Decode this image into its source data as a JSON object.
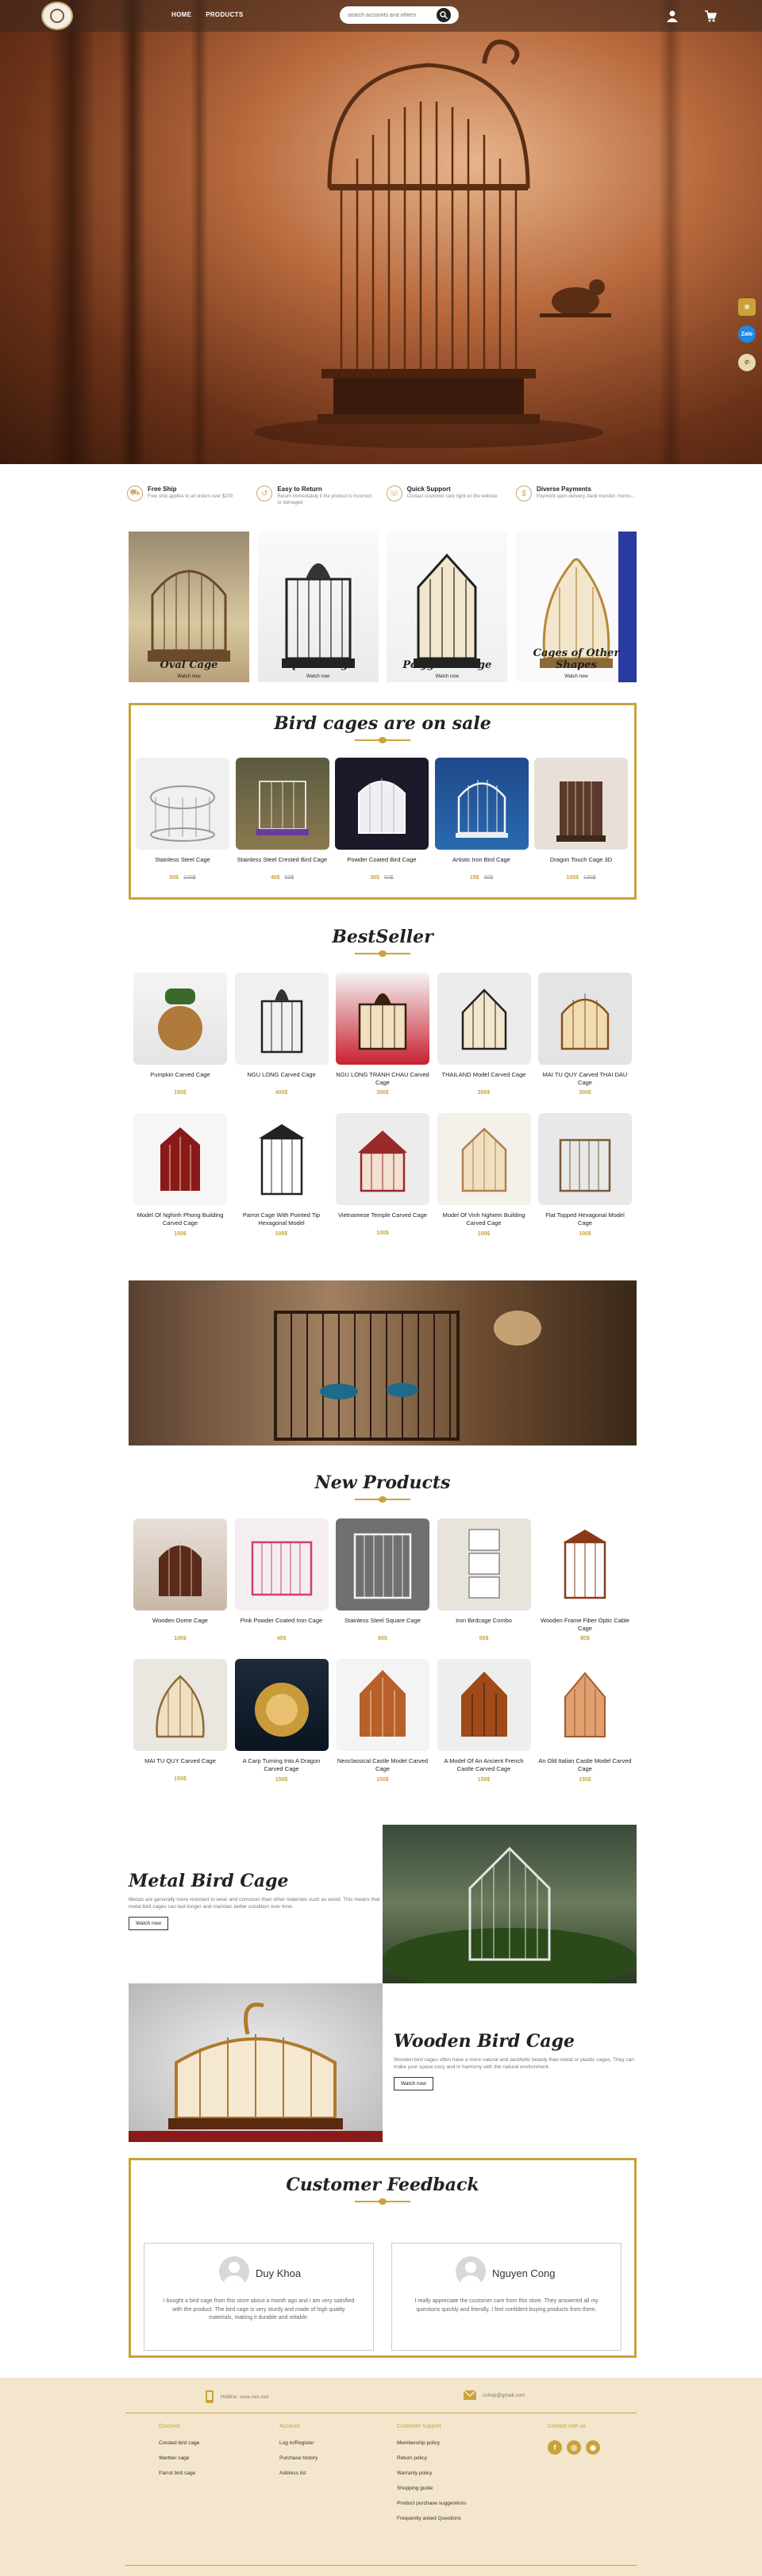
{
  "header": {
    "nav": [
      "HOME",
      "PRODUCTS"
    ],
    "search_placeholder": "search accounts and others"
  },
  "features": [
    {
      "title": "Free Ship",
      "desc": "Free ship applies to all orders over $200"
    },
    {
      "title": "Easy to Return",
      "desc": "Return immediately if the product is incorrect or damaged"
    },
    {
      "title": "Quick Support",
      "desc": "Contact customer care right on the website"
    },
    {
      "title": "Diverse Payments",
      "desc": "Payment upon delivery, bank transfer, momo..."
    }
  ],
  "categories": [
    {
      "label": "Oval Cage",
      "link": "Watch now"
    },
    {
      "label": "Square Cage",
      "link": "Watch now"
    },
    {
      "label": "Polygonal Cage",
      "link": "Watch now"
    },
    {
      "label": "Cages of Other Shapes",
      "link": "Watch now"
    }
  ],
  "sale": {
    "title": "Bird cages are on sale",
    "products": [
      {
        "name": "Stainless Steel Cage",
        "price": "50$",
        "old": "100$"
      },
      {
        "name": "Stainless Steel Crested Bird Cage",
        "price": "40$",
        "old": "60$"
      },
      {
        "name": "Powder Coated Bird Cage",
        "price": "30$",
        "old": "50$"
      },
      {
        "name": "Artistic Iron Bird Cage",
        "price": "15$",
        "old": "30$"
      },
      {
        "name": "Dragon Touch Cage 3D",
        "price": "100$",
        "old": "130$"
      }
    ]
  },
  "bestseller": {
    "title": "BestSeller",
    "row1": [
      {
        "name": "Pumpkin Carved Cage",
        "price": "150$"
      },
      {
        "name": "NGU LONG Carved Cage",
        "price": "400$"
      },
      {
        "name": "NGU LONG TRANH CHAU Carved Cage",
        "price": "300$"
      },
      {
        "name": "THAILAND Model Carved Cage",
        "price": "350$"
      },
      {
        "name": "MAI TU QUY Carved THAI DAU Cage",
        "price": "300$"
      }
    ],
    "row2": [
      {
        "name": "Model Of Nghinh Phong Building Carved Cage",
        "price": "150$"
      },
      {
        "name": "Parrot Cage With Pointed Tip Hexagonal Model",
        "price": "100$"
      },
      {
        "name": "Vietnamese Temple Carved Cage",
        "price": "100$"
      },
      {
        "name": "Model Of Vinh Nghiem Building Carved Cage",
        "price": "100$"
      },
      {
        "name": "Flat Topped Hexagonal Model Cage",
        "price": "100$"
      }
    ]
  },
  "new_products": {
    "title": "New Products",
    "row1": [
      {
        "name": "Wooden Dome Cage",
        "price": "100$"
      },
      {
        "name": "Pink Powder Coated Iron Cage",
        "price": "40$"
      },
      {
        "name": "Stainless Steel Square Cage",
        "price": "60$"
      },
      {
        "name": "Iron Birdcage Combo",
        "price": "50$"
      },
      {
        "name": "Wooden Frame Fiber Optic Cable Cage",
        "price": "80$"
      }
    ],
    "row2": [
      {
        "name": "MAI TU QUY Carved Cage",
        "price": "150$"
      },
      {
        "name": "A Carp Turning Into A Dragon Carved Cage",
        "price": "150$"
      },
      {
        "name": "Neoclassical Castle Model Carved Cage",
        "price": "150$"
      },
      {
        "name": "A Model Of An Ancient French Castle Carved Cage",
        "price": "150$"
      },
      {
        "name": "An Old Italian Castle Model Carved Cage",
        "price": "150$"
      }
    ]
  },
  "metal": {
    "title": "Metal Bird Cage",
    "desc": "Metals are generally more resistant to wear and corrosion than other materials such as wood. This means that metal bird cages can last longer and maintain better condition over time.",
    "button": "Watch now"
  },
  "wooden": {
    "title": "Wooden Bird Cage",
    "desc": "Wooden bird cages often have a more natural and aesthetic beauty than metal or plastic cages. They can make your space cozy and in harmony with the natural environment.",
    "button": "Watch now"
  },
  "feedback": {
    "title": "Customer Feedback",
    "items": [
      {
        "name": "Duy Khoa",
        "text": "I bought a bird cage from this store about a month ago and I am very satisfied with the product. The bird cage is very sturdy and made of high quality materials, making it durable and reliable."
      },
      {
        "name": "Nguyen Cong",
        "text": "I really appreciate the customer care from this store. They answered all my questions quickly and friendly. I feel confident buying products from them."
      }
    ]
  },
  "footer": {
    "hotline": "Hotline: xxxx-xxx-xxx",
    "email": "cshop@gmail.com",
    "cols": [
      {
        "title": "Discover",
        "items": [
          "Crested bird cage",
          "Warbler cage",
          "Parrot bird cage"
        ]
      },
      {
        "title": "Account",
        "items": [
          "Log in/Register",
          "Purchase history",
          "Address list"
        ]
      },
      {
        "title": "Customer support",
        "items": [
          "Membership policy",
          "Return policy",
          "Warranty policy",
          "Shopping guide",
          "Product purchase suggestions",
          "Frequently asked Questions"
        ]
      },
      {
        "title": "Contact with us",
        "items": []
      }
    ]
  }
}
